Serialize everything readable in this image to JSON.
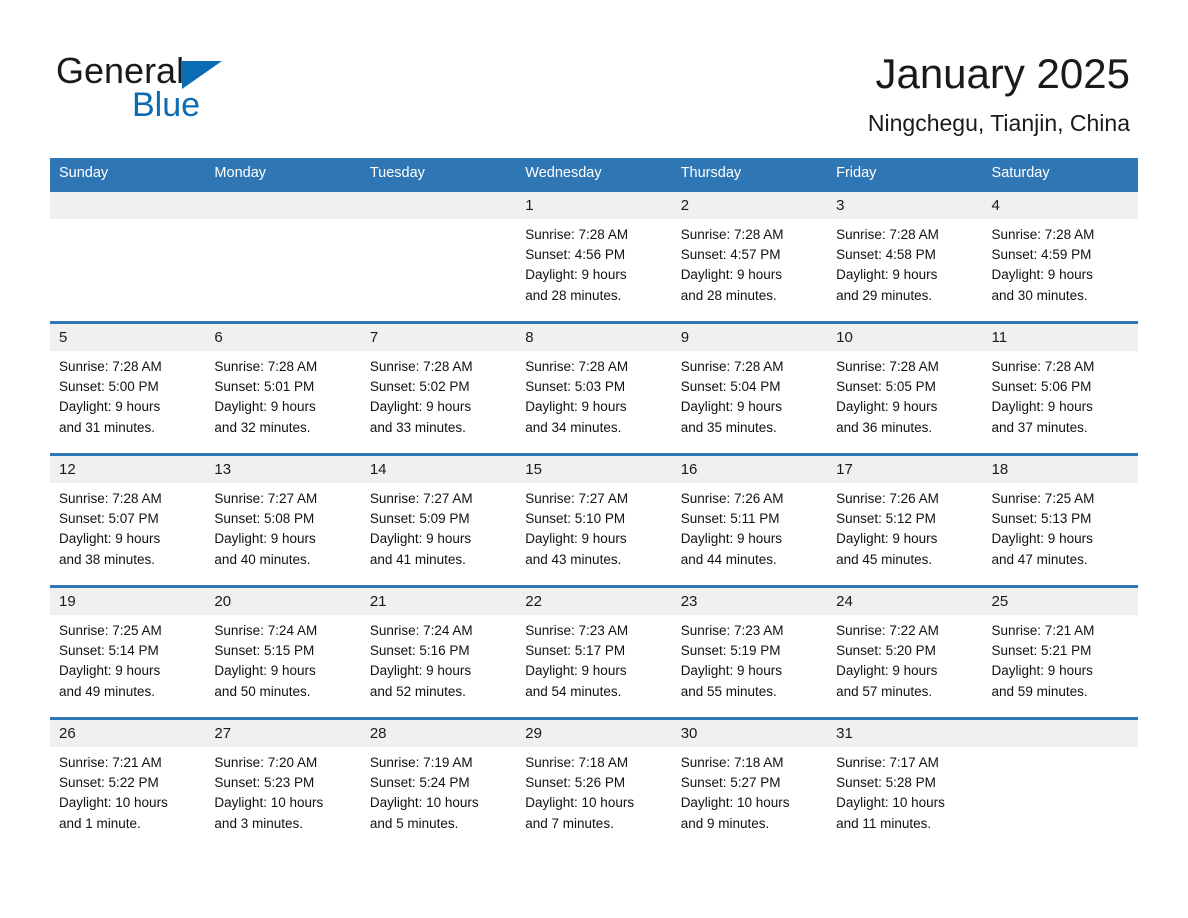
{
  "brand": {
    "name_part1": "General",
    "name_part2": "Blue",
    "accent_color": "#0b6cb3"
  },
  "header": {
    "title": "January 2025",
    "subtitle": "Ningchegu, Tianjin, China"
  },
  "theme": {
    "header_bar_color": "#2f76b5",
    "day_band_color": "#f0f0f0",
    "row_rule_color": "#2f76b5"
  },
  "weekdays": [
    "Sunday",
    "Monday",
    "Tuesday",
    "Wednesday",
    "Thursday",
    "Friday",
    "Saturday"
  ],
  "weeks": [
    [
      {
        "day": "",
        "empty": true
      },
      {
        "day": "",
        "empty": true
      },
      {
        "day": "",
        "empty": true
      },
      {
        "day": "1",
        "sunrise": "Sunrise: 7:28 AM",
        "sunset": "Sunset: 4:56 PM",
        "daylight_line1": "Daylight: 9 hours",
        "daylight_line2": "and 28 minutes."
      },
      {
        "day": "2",
        "sunrise": "Sunrise: 7:28 AM",
        "sunset": "Sunset: 4:57 PM",
        "daylight_line1": "Daylight: 9 hours",
        "daylight_line2": "and 28 minutes."
      },
      {
        "day": "3",
        "sunrise": "Sunrise: 7:28 AM",
        "sunset": "Sunset: 4:58 PM",
        "daylight_line1": "Daylight: 9 hours",
        "daylight_line2": "and 29 minutes."
      },
      {
        "day": "4",
        "sunrise": "Sunrise: 7:28 AM",
        "sunset": "Sunset: 4:59 PM",
        "daylight_line1": "Daylight: 9 hours",
        "daylight_line2": "and 30 minutes."
      }
    ],
    [
      {
        "day": "5",
        "sunrise": "Sunrise: 7:28 AM",
        "sunset": "Sunset: 5:00 PM",
        "daylight_line1": "Daylight: 9 hours",
        "daylight_line2": "and 31 minutes."
      },
      {
        "day": "6",
        "sunrise": "Sunrise: 7:28 AM",
        "sunset": "Sunset: 5:01 PM",
        "daylight_line1": "Daylight: 9 hours",
        "daylight_line2": "and 32 minutes."
      },
      {
        "day": "7",
        "sunrise": "Sunrise: 7:28 AM",
        "sunset": "Sunset: 5:02 PM",
        "daylight_line1": "Daylight: 9 hours",
        "daylight_line2": "and 33 minutes."
      },
      {
        "day": "8",
        "sunrise": "Sunrise: 7:28 AM",
        "sunset": "Sunset: 5:03 PM",
        "daylight_line1": "Daylight: 9 hours",
        "daylight_line2": "and 34 minutes."
      },
      {
        "day": "9",
        "sunrise": "Sunrise: 7:28 AM",
        "sunset": "Sunset: 5:04 PM",
        "daylight_line1": "Daylight: 9 hours",
        "daylight_line2": "and 35 minutes."
      },
      {
        "day": "10",
        "sunrise": "Sunrise: 7:28 AM",
        "sunset": "Sunset: 5:05 PM",
        "daylight_line1": "Daylight: 9 hours",
        "daylight_line2": "and 36 minutes."
      },
      {
        "day": "11",
        "sunrise": "Sunrise: 7:28 AM",
        "sunset": "Sunset: 5:06 PM",
        "daylight_line1": "Daylight: 9 hours",
        "daylight_line2": "and 37 minutes."
      }
    ],
    [
      {
        "day": "12",
        "sunrise": "Sunrise: 7:28 AM",
        "sunset": "Sunset: 5:07 PM",
        "daylight_line1": "Daylight: 9 hours",
        "daylight_line2": "and 38 minutes."
      },
      {
        "day": "13",
        "sunrise": "Sunrise: 7:27 AM",
        "sunset": "Sunset: 5:08 PM",
        "daylight_line1": "Daylight: 9 hours",
        "daylight_line2": "and 40 minutes."
      },
      {
        "day": "14",
        "sunrise": "Sunrise: 7:27 AM",
        "sunset": "Sunset: 5:09 PM",
        "daylight_line1": "Daylight: 9 hours",
        "daylight_line2": "and 41 minutes."
      },
      {
        "day": "15",
        "sunrise": "Sunrise: 7:27 AM",
        "sunset": "Sunset: 5:10 PM",
        "daylight_line1": "Daylight: 9 hours",
        "daylight_line2": "and 43 minutes."
      },
      {
        "day": "16",
        "sunrise": "Sunrise: 7:26 AM",
        "sunset": "Sunset: 5:11 PM",
        "daylight_line1": "Daylight: 9 hours",
        "daylight_line2": "and 44 minutes."
      },
      {
        "day": "17",
        "sunrise": "Sunrise: 7:26 AM",
        "sunset": "Sunset: 5:12 PM",
        "daylight_line1": "Daylight: 9 hours",
        "daylight_line2": "and 45 minutes."
      },
      {
        "day": "18",
        "sunrise": "Sunrise: 7:25 AM",
        "sunset": "Sunset: 5:13 PM",
        "daylight_line1": "Daylight: 9 hours",
        "daylight_line2": "and 47 minutes."
      }
    ],
    [
      {
        "day": "19",
        "sunrise": "Sunrise: 7:25 AM",
        "sunset": "Sunset: 5:14 PM",
        "daylight_line1": "Daylight: 9 hours",
        "daylight_line2": "and 49 minutes."
      },
      {
        "day": "20",
        "sunrise": "Sunrise: 7:24 AM",
        "sunset": "Sunset: 5:15 PM",
        "daylight_line1": "Daylight: 9 hours",
        "daylight_line2": "and 50 minutes."
      },
      {
        "day": "21",
        "sunrise": "Sunrise: 7:24 AM",
        "sunset": "Sunset: 5:16 PM",
        "daylight_line1": "Daylight: 9 hours",
        "daylight_line2": "and 52 minutes."
      },
      {
        "day": "22",
        "sunrise": "Sunrise: 7:23 AM",
        "sunset": "Sunset: 5:17 PM",
        "daylight_line1": "Daylight: 9 hours",
        "daylight_line2": "and 54 minutes."
      },
      {
        "day": "23",
        "sunrise": "Sunrise: 7:23 AM",
        "sunset": "Sunset: 5:19 PM",
        "daylight_line1": "Daylight: 9 hours",
        "daylight_line2": "and 55 minutes."
      },
      {
        "day": "24",
        "sunrise": "Sunrise: 7:22 AM",
        "sunset": "Sunset: 5:20 PM",
        "daylight_line1": "Daylight: 9 hours",
        "daylight_line2": "and 57 minutes."
      },
      {
        "day": "25",
        "sunrise": "Sunrise: 7:21 AM",
        "sunset": "Sunset: 5:21 PM",
        "daylight_line1": "Daylight: 9 hours",
        "daylight_line2": "and 59 minutes."
      }
    ],
    [
      {
        "day": "26",
        "sunrise": "Sunrise: 7:21 AM",
        "sunset": "Sunset: 5:22 PM",
        "daylight_line1": "Daylight: 10 hours",
        "daylight_line2": "and 1 minute."
      },
      {
        "day": "27",
        "sunrise": "Sunrise: 7:20 AM",
        "sunset": "Sunset: 5:23 PM",
        "daylight_line1": "Daylight: 10 hours",
        "daylight_line2": "and 3 minutes."
      },
      {
        "day": "28",
        "sunrise": "Sunrise: 7:19 AM",
        "sunset": "Sunset: 5:24 PM",
        "daylight_line1": "Daylight: 10 hours",
        "daylight_line2": "and 5 minutes."
      },
      {
        "day": "29",
        "sunrise": "Sunrise: 7:18 AM",
        "sunset": "Sunset: 5:26 PM",
        "daylight_line1": "Daylight: 10 hours",
        "daylight_line2": "and 7 minutes."
      },
      {
        "day": "30",
        "sunrise": "Sunrise: 7:18 AM",
        "sunset": "Sunset: 5:27 PM",
        "daylight_line1": "Daylight: 10 hours",
        "daylight_line2": "and 9 minutes."
      },
      {
        "day": "31",
        "sunrise": "Sunrise: 7:17 AM",
        "sunset": "Sunset: 5:28 PM",
        "daylight_line1": "Daylight: 10 hours",
        "daylight_line2": "and 11 minutes."
      },
      {
        "day": "",
        "empty": true
      }
    ]
  ]
}
